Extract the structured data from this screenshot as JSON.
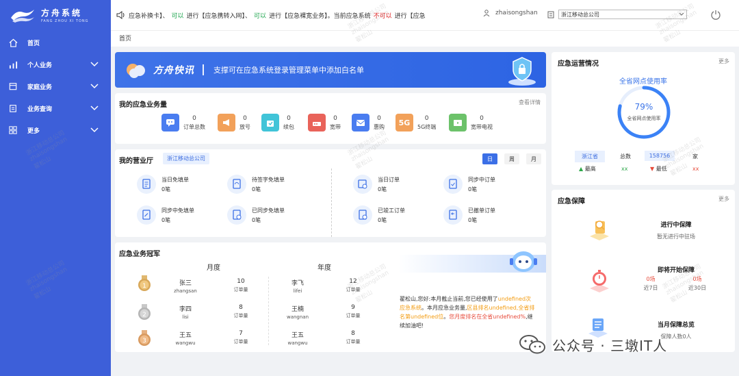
{
  "app": {
    "title": "方舟系统",
    "subtitle": "FANG ZHOU XI TONG"
  },
  "sidebar": {
    "items": [
      {
        "label": "首页",
        "icon": "home-icon"
      },
      {
        "label": "个人业务",
        "icon": "bar-chart-icon"
      },
      {
        "label": "家庭业务",
        "icon": "calendar-icon"
      },
      {
        "label": "业务查询",
        "icon": "clipboard-icon"
      },
      {
        "label": "更多",
        "icon": "grid-icon"
      }
    ]
  },
  "header": {
    "notice": {
      "p1": "应急补换卡】、",
      "p2": "可以",
      "p3": "进行【应急携转入网】、",
      "p4": "可以",
      "p5": "进行【应急裸宽业务】。当前应急系统",
      "p6": "不可以",
      "p7": "进行【应急"
    },
    "username": "zhaisongshan",
    "org_select": "浙江移动总公司"
  },
  "breadcrumb": "首页",
  "banner": {
    "title": "方舟快讯",
    "text": "支撑可在应急系统登录管理菜单中添加白名单"
  },
  "volume": {
    "title": "我的应急业务量",
    "more": "查看详情",
    "items": [
      {
        "value": "0",
        "label": "订单总数"
      },
      {
        "value": "0",
        "label": "放号"
      },
      {
        "value": "0",
        "label": "续包"
      },
      {
        "value": "0",
        "label": "宽带"
      },
      {
        "value": "0",
        "label": "惠购"
      },
      {
        "value": "0",
        "label": "5G终端"
      },
      {
        "value": "0",
        "label": "宽带电视"
      }
    ]
  },
  "hall": {
    "title": "我的营业厅",
    "org": "浙江移动总公司",
    "periods": [
      "日",
      "周",
      "月"
    ],
    "items": [
      {
        "label": "当日免填单",
        "value": "0笔"
      },
      {
        "label": "待签字免填单",
        "value": "0笔"
      },
      {
        "label": "当日订单",
        "value": "0笔"
      },
      {
        "label": "同步中订单",
        "value": "0笔"
      },
      {
        "label": "同步中免填单",
        "value": "0笔"
      },
      {
        "label": "已同步免填单",
        "value": "0笔"
      },
      {
        "label": "已竣工订单",
        "value": "0笔"
      },
      {
        "label": "已撤单订单",
        "value": "0笔"
      }
    ]
  },
  "champion": {
    "title": "应急业务冠军",
    "month_label": "月度",
    "year_label": "年度",
    "month": [
      {
        "name": "张三",
        "pinyin": "zhangsan",
        "value": "10",
        "unit": "订单量"
      },
      {
        "name": "李四",
        "pinyin": "lisi",
        "value": "8",
        "unit": "订单量"
      },
      {
        "name": "王五",
        "pinyin": "wangwu",
        "value": "7",
        "unit": "订单量"
      }
    ],
    "year": [
      {
        "name": "李飞",
        "pinyin": "lifei",
        "value": "12",
        "unit": "订单量"
      },
      {
        "name": "王楠",
        "pinyin": "wangnan",
        "value": "9",
        "unit": "订单量"
      },
      {
        "name": "王五",
        "pinyin": "wangwu",
        "value": "8",
        "unit": "订单量"
      }
    ],
    "message": {
      "m1": "翟松山,您好:本月截止当前,您已经使用了",
      "m2": "undefined次应急系统",
      "m3": "。本月应急业务量,",
      "m4": "区县排名undefined,全省排名第undefined位",
      "m5": "。",
      "m6": "您月度排名在全省undefined%",
      "m7": ",继续加油吧!"
    }
  },
  "ops": {
    "title": "应急运营情况",
    "more": "更多",
    "gauge_title": "全省网点使用率",
    "gauge_value": "79%",
    "gauge_percent": 79,
    "gauge_label": "全省网点使用率",
    "province": "浙江省",
    "total_label": "总数",
    "total": "158756",
    "unit": "家",
    "max_label": "最高",
    "max_val": "xx",
    "min_label": "最低",
    "min_val": "xx"
  },
  "guarantee": {
    "title": "应急保障",
    "more": "更多",
    "ongoing_title": "进行中保障",
    "ongoing_sub": "暂无进行中驻场",
    "upcoming_title": "即将开始保障",
    "upcoming_7": "0场",
    "upcoming_7_label": "近7日",
    "upcoming_30": "0场",
    "upcoming_30_label": "近30日",
    "month_title": "当月保障总览",
    "month_sub": "保障人数0人"
  },
  "watermark": {
    "org": "浙江移动总公司",
    "user": "zhaisongshan",
    "name": "翟松山"
  },
  "footer": {
    "text": "公众号 · 三墩IT人"
  },
  "colors": {
    "sidebar": "#3d5fd9",
    "accent": "#3b6fe6",
    "green": "#19a34a",
    "red": "#e02020",
    "orange": "#f39c12"
  }
}
